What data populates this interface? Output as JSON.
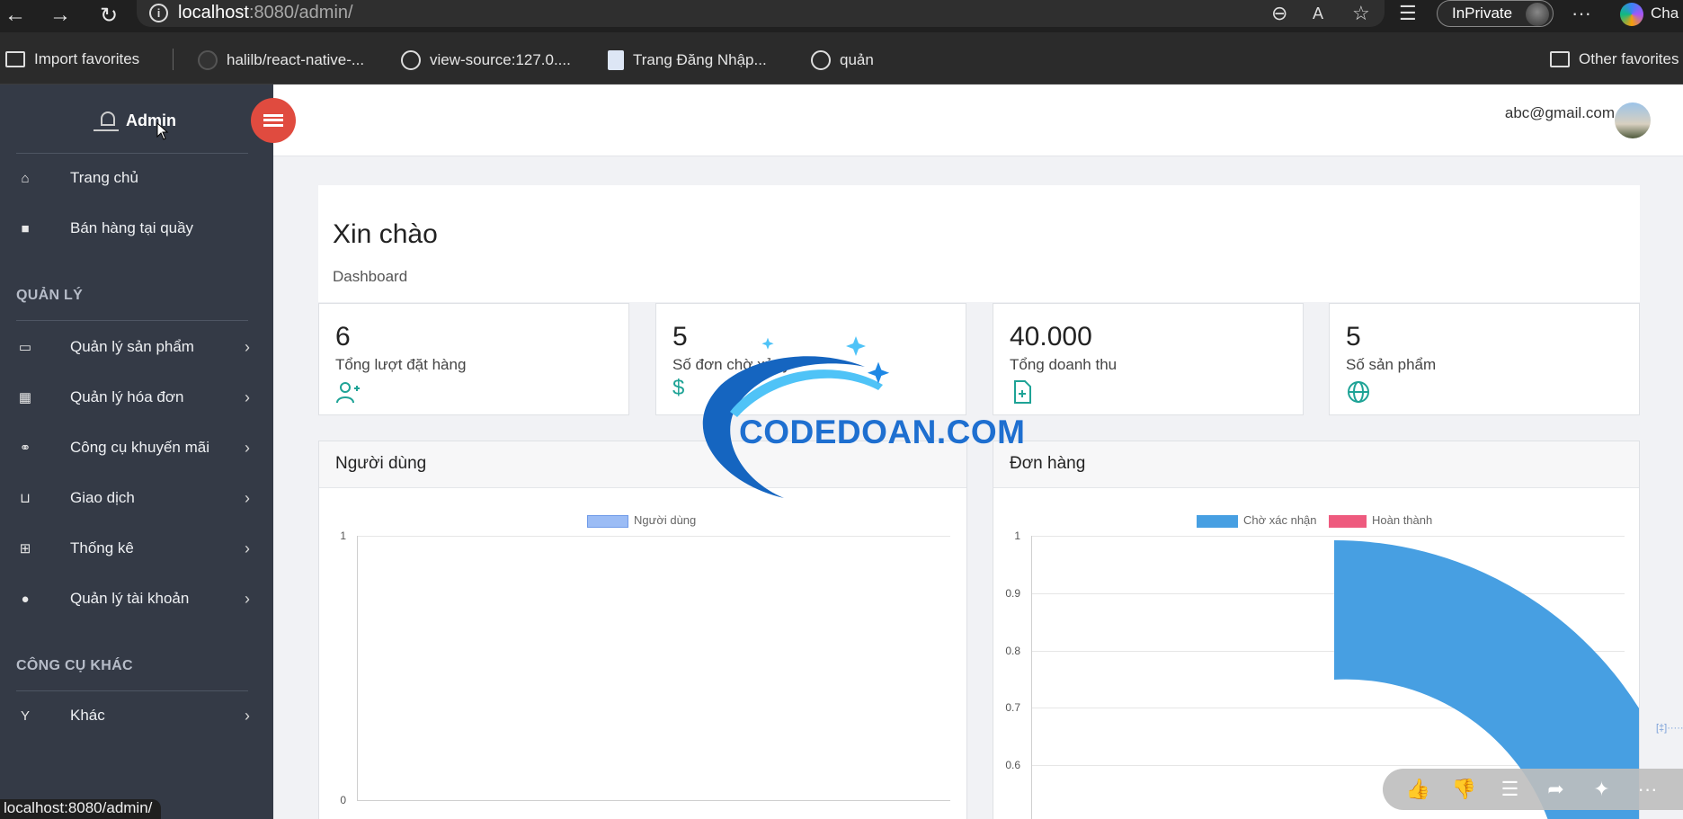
{
  "browser": {
    "url_host": "localhost",
    "url_rest": ":8080/admin/",
    "inprivate_label": "InPrivate",
    "copilot_label": "Cha",
    "favorites": [
      {
        "label": "Import favorites",
        "icon": "import-icon"
      },
      {
        "label": "halilb/react-native-...",
        "icon": "github-icon"
      },
      {
        "label": "view-source:127.0....",
        "icon": "globe-icon"
      },
      {
        "label": "Trang Đăng Nhập...",
        "icon": "page-icon"
      },
      {
        "label": "quản",
        "icon": "globe-icon"
      }
    ],
    "other_favorites": "Other favorites",
    "status_url": "localhost:8080/admin/"
  },
  "sidebar": {
    "brand_title": "Admin",
    "items_top": [
      {
        "label": "Trang chủ",
        "icon": "home-icon"
      },
      {
        "label": "Bán hàng tại quầy",
        "icon": "bag-icon"
      }
    ],
    "section_manage": "QUẢN LÝ",
    "items_manage": [
      {
        "label": "Quản lý sản phẩm",
        "icon": "laptop-icon"
      },
      {
        "label": "Quản lý hóa đơn",
        "icon": "table-icon"
      },
      {
        "label": "Công cụ khuyến mãi",
        "icon": "handshake-icon"
      },
      {
        "label": "Giao dịch",
        "icon": "basket-icon"
      },
      {
        "label": "Thống kê",
        "icon": "sitemap-icon"
      },
      {
        "label": "Quản lý tài khoản",
        "icon": "user-icon"
      }
    ],
    "section_other": "CÔNG CỤ KHÁC",
    "items_other": [
      {
        "label": "Khác",
        "icon": "cocktail-icon"
      }
    ]
  },
  "header": {
    "email": "abc@gmail.com"
  },
  "welcome": {
    "title": "Xin chào",
    "subtitle": "Dashboard"
  },
  "stats": [
    {
      "value": "6",
      "label": "Tổng lượt đặt hàng",
      "icon": "user-plus-icon"
    },
    {
      "value": "5",
      "label": "Số đơn chờ xử lý",
      "icon": "dollar-icon"
    },
    {
      "value": "40.000",
      "label": "Tổng doanh thu",
      "icon": "file-plus-icon"
    },
    {
      "value": "5",
      "label": "Số sản phẩm",
      "icon": "globe-icon"
    }
  ],
  "watermark": "CODEDOAN.COM",
  "chart_data": [
    {
      "type": "bar",
      "title": "Người dùng",
      "series": [
        {
          "name": "Người dùng",
          "values": [],
          "color": "#9bbcf5"
        }
      ],
      "ylim": [
        0,
        1
      ],
      "yticks": [
        "1",
        "0"
      ]
    },
    {
      "type": "pie",
      "title": "Đơn hàng",
      "series": [
        {
          "name": "Chờ xác nhận",
          "color": "#479fe2"
        },
        {
          "name": "Hoàn thành",
          "color": "#ee5a7e"
        }
      ],
      "yticks": [
        "1",
        "0.9",
        "0.8",
        "0.7",
        "0.6"
      ]
    }
  ]
}
